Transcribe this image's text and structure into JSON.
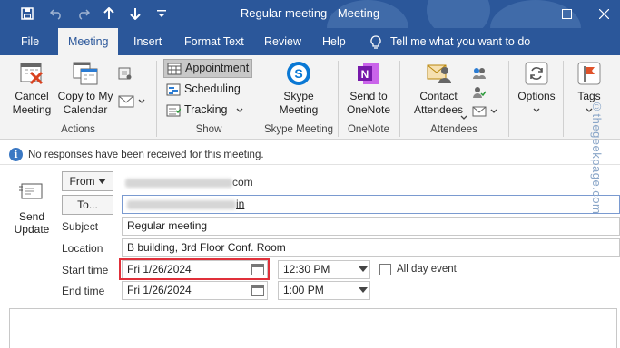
{
  "window": {
    "title": "Regular meeting  -  Meeting",
    "quick_access": [
      "save-icon",
      "undo-icon",
      "redo-icon",
      "up-arrow-icon",
      "down-arrow-icon",
      "customize-icon"
    ],
    "controls": [
      "restore-icon",
      "close-icon"
    ]
  },
  "menu": {
    "tabs": [
      "File",
      "Meeting",
      "Insert",
      "Format Text",
      "Review",
      "Help"
    ],
    "active": "Meeting",
    "tell_me": "Tell me what you want to do"
  },
  "ribbon": {
    "actions": {
      "label": "Actions",
      "cancel": "Cancel\nMeeting",
      "copy": "Copy to My\nCalendar"
    },
    "show": {
      "label": "Show",
      "appointment": "Appointment",
      "scheduling": "Scheduling",
      "tracking": "Tracking"
    },
    "skype": {
      "label": "Skype Meeting",
      "button": "Skype\nMeeting"
    },
    "onenote": {
      "label": "OneNote",
      "button": "Send to\nOneNote"
    },
    "attendees": {
      "label": "Attendees",
      "contact": "Contact\nAttendees"
    },
    "options": {
      "label": "Options"
    },
    "tags": {
      "label": "Tags"
    }
  },
  "info": {
    "text": "No responses have been received for this meeting."
  },
  "form": {
    "send_update": "Send\nUpdate",
    "from_button": "From",
    "from_suffix": "com",
    "to_button": "To...",
    "to_suffix": "in",
    "subject_label": "Subject",
    "subject": "Regular meeting",
    "location_label": "Location",
    "location": "B building, 3rd Floor Conf. Room",
    "start_label": "Start time",
    "start_date": "Fri 1/26/2024",
    "start_time": "12:30 PM",
    "all_day_label": "All day event",
    "end_label": "End time",
    "end_date": "Fri 1/26/2024",
    "end_time": "1:00 PM"
  },
  "watermark": "©thegeekpage.com",
  "colors": {
    "brand": "#2b579a",
    "highlight": "#e0303a"
  }
}
